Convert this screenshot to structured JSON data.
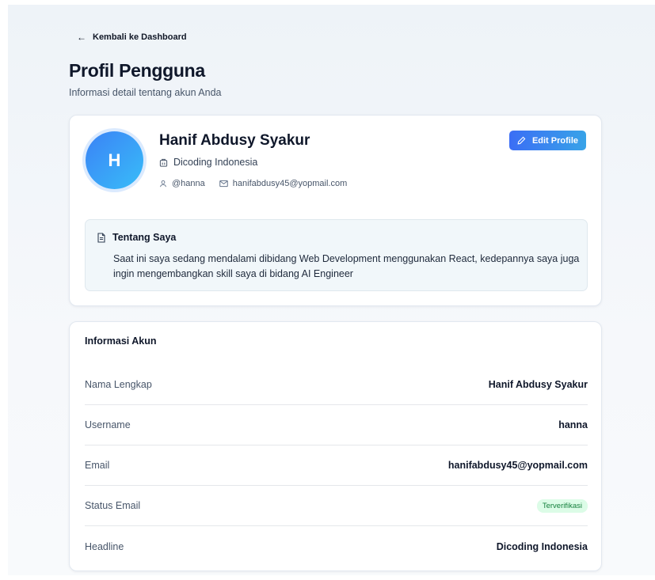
{
  "nav": {
    "back_label": "Kembali ke Dashboard",
    "back_icon": "arrow-left-icon"
  },
  "header": {
    "title": "Profil Pengguna",
    "subtitle": "Informasi detail tentang akun Anda"
  },
  "profile": {
    "avatar_initial": "H",
    "name": "Hanif Abdusy Syakur",
    "organization": "Dicoding Indonesia",
    "username": "@hanna",
    "email": "hanifabdusy45@yopmail.com",
    "edit_label": "Edit Profile",
    "about_title": "Tentang Saya",
    "about_text": "Saat ini saya sedang mendalami dibidang Web Development menggunakan React, kedepannya saya juga ingin mengembangkan skill saya di bidang AI Engineer"
  },
  "account": {
    "title": "Informasi Akun",
    "rows": [
      {
        "label": "Nama Lengkap",
        "value": "Hanif Abdusy Syakur"
      },
      {
        "label": "Username",
        "value": "hanna"
      },
      {
        "label": "Email",
        "value": "hanifabdusy45@yopmail.com"
      },
      {
        "label": "Status Email",
        "value": "Terverifikasi"
      },
      {
        "label": "Headline",
        "value": "Dicoding Indonesia"
      }
    ]
  },
  "colors": {
    "accent": "#3b6ef5",
    "verified_bg": "#dcfce7",
    "verified_text": "#15803d"
  }
}
